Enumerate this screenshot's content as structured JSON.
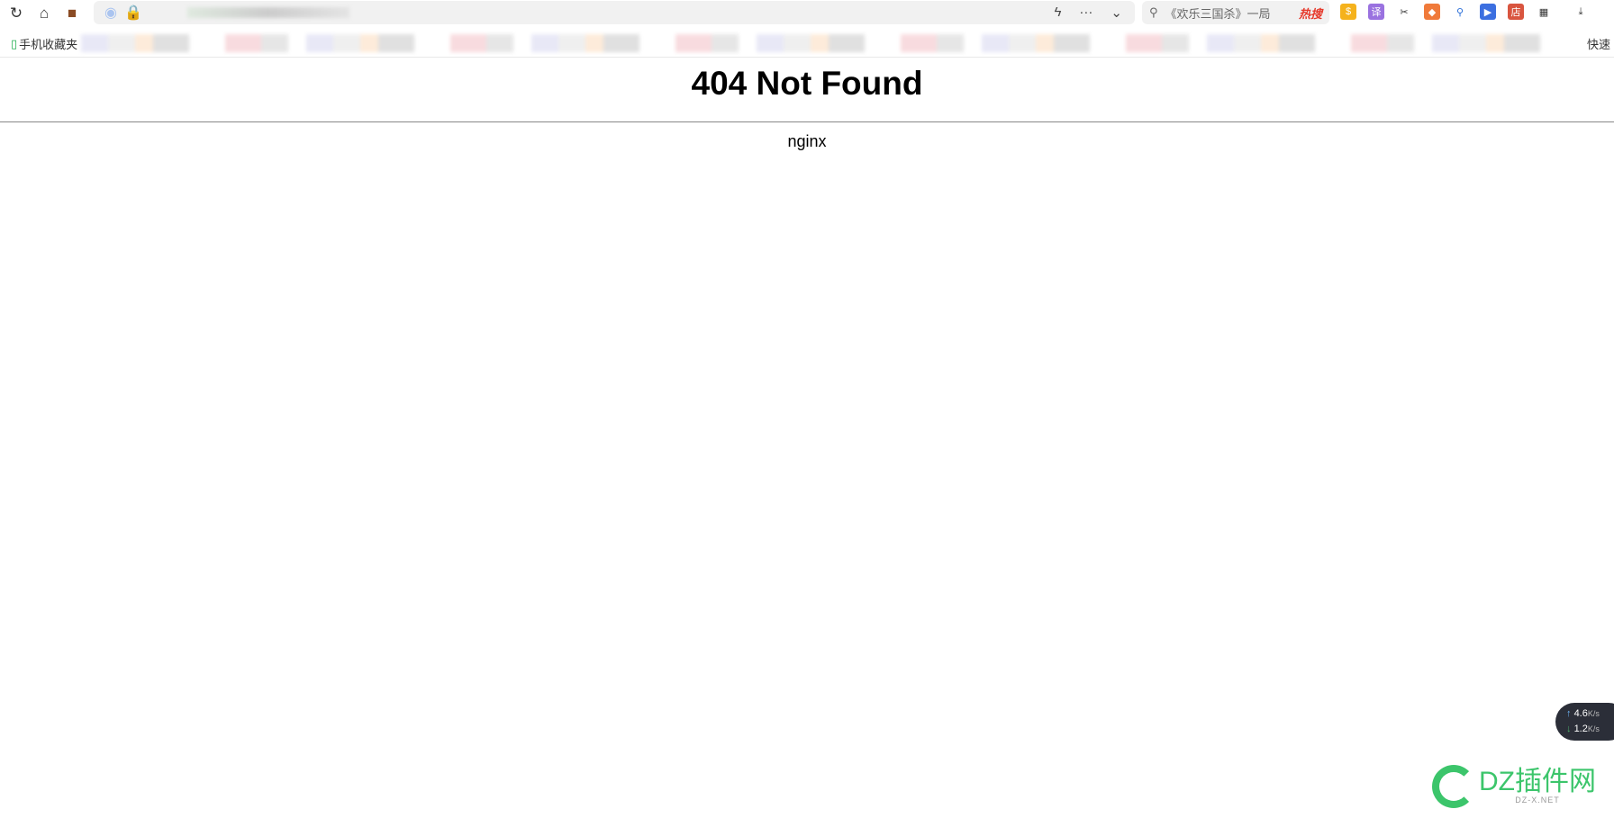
{
  "toolbar": {
    "reload_icon": "reload-icon",
    "home_icon": "home-icon",
    "briefcase_icon": "briefcase-icon",
    "more": "···",
    "search_text": "《欢乐三国杀》一局",
    "hot_label": "热搜"
  },
  "bookmarks": {
    "first": "手机收藏夹",
    "last": "快速"
  },
  "page": {
    "title": "404 Not Found",
    "server": "nginx"
  },
  "speed": {
    "up": "4.6",
    "down": "1.2",
    "unit": "K/s"
  },
  "watermark": {
    "name": "DZ插件网",
    "url": "DZ-X.NET"
  }
}
